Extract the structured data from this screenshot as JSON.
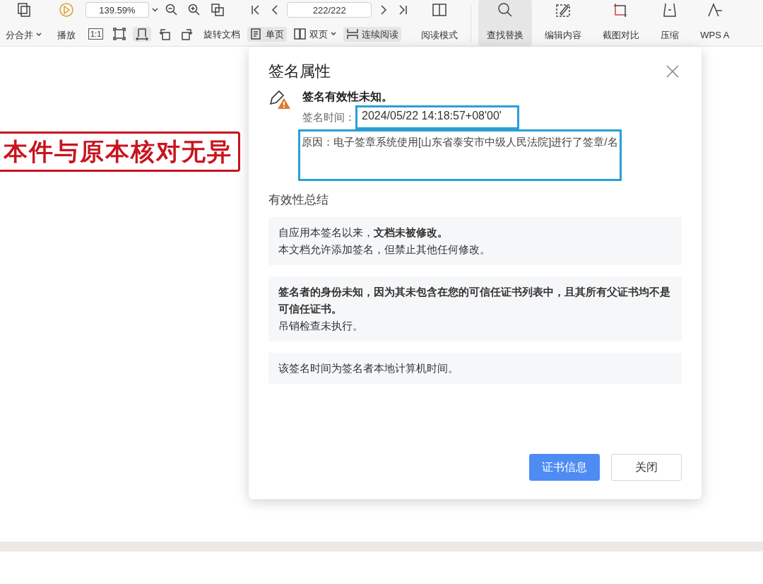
{
  "toolbar": {
    "left_buttons": [
      {
        "label": "分合并",
        "dropdown": true,
        "selected": false
      },
      {
        "label": "播放",
        "dropdown": false,
        "selected": false
      }
    ],
    "zoom_field": {
      "value": "139.59%"
    },
    "actual_size_label": "1:1",
    "view_tools": [
      {
        "selected": false
      },
      {
        "selected": true
      }
    ],
    "rotate_label": "旋转文档",
    "page_field": {
      "value": "222/222"
    },
    "layout_buttons": [
      {
        "label": "单页",
        "dropdown": false,
        "selected": true
      },
      {
        "label": "双页",
        "dropdown": true,
        "selected": false
      },
      {
        "label": "连续阅读",
        "dropdown": false,
        "selected": true
      }
    ],
    "reading_mode": "阅读模式",
    "tools": [
      {
        "label": "查找替换",
        "selected": true
      },
      {
        "label": "编辑内容",
        "selected": false
      },
      {
        "label": "截图对比",
        "selected": false
      },
      {
        "label": "压缩",
        "selected": false
      },
      {
        "label": "WPS A",
        "selected": false
      }
    ]
  },
  "document": {
    "stamp_text": "本件与原本核对无异"
  },
  "dialog": {
    "title": "签名属性",
    "status": {
      "heading": "签名有效性未知。",
      "time_label": "签名时间：",
      "time_value": "2024/05/22 14:18:57+08'00'",
      "time_highlighted": true,
      "reason": "原因：电子签章系统使用[山东省泰安市中级人民法院]进行了签章/名",
      "reason_highlighted": true
    },
    "summary_title": "有效性总结",
    "summary": [
      {
        "lines": [
          {
            "text": "自应用本签名以来，**文档未被修改。**",
            "bold": false
          },
          {
            "text": "本文档允许添加签名，但禁止其他任何修改。",
            "bold": false
          }
        ]
      },
      {
        "lines": [
          {
            "text": "签名者的身份未知，因为其未包含在您的可信任证书列表中，且其所有父证书均不是可信任证书。",
            "bold": true
          },
          {
            "text": "吊销检查未执行。",
            "bold": false
          }
        ]
      },
      {
        "lines": [
          {
            "text": "该签名时间为签名者本地计算机时间。",
            "bold": false
          }
        ]
      }
    ],
    "buttons": [
      {
        "label": "证书信息",
        "primary": true
      },
      {
        "label": "关闭",
        "primary": false
      }
    ]
  }
}
